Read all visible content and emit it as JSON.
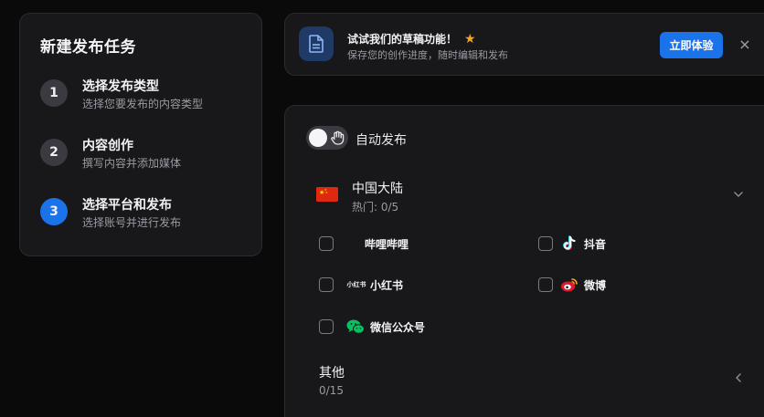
{
  "steps": {
    "title": "新建发布任务",
    "items": [
      {
        "num": "1",
        "title": "选择发布类型",
        "sub": "选择您要发布的内容类型"
      },
      {
        "num": "2",
        "title": "内容创作",
        "sub": "撰写内容并添加媒体"
      },
      {
        "num": "3",
        "title": "选择平台和发布",
        "sub": "选择账号并进行发布"
      }
    ]
  },
  "banner": {
    "title": "试试我们的草稿功能！",
    "sub": "保存您的创作进度，随时编辑和发布",
    "button": "立即体验",
    "close": "×",
    "star": "★"
  },
  "main": {
    "auto_publish": "自动发布",
    "region": {
      "title": "中国大陆",
      "sub": "热门: 0/5"
    },
    "platforms": [
      {
        "label": "哔哩哔哩",
        "icon": "bilibili-icon"
      },
      {
        "label": "抖音",
        "icon": "douyin-icon"
      },
      {
        "label": "小红书",
        "icon": "xiaohongshu-icon",
        "icon_text": "小红书"
      },
      {
        "label": "微博",
        "icon": "weibo-icon"
      },
      {
        "label": "微信公众号",
        "icon": "wechat-icon"
      }
    ],
    "other": {
      "title": "其他",
      "sub": "0/15"
    }
  },
  "colors": {
    "accent": "#1a73e8",
    "background": "#0a0a0b",
    "card": "#18181b",
    "star": "#f5a524",
    "wechat": "#07c160"
  }
}
